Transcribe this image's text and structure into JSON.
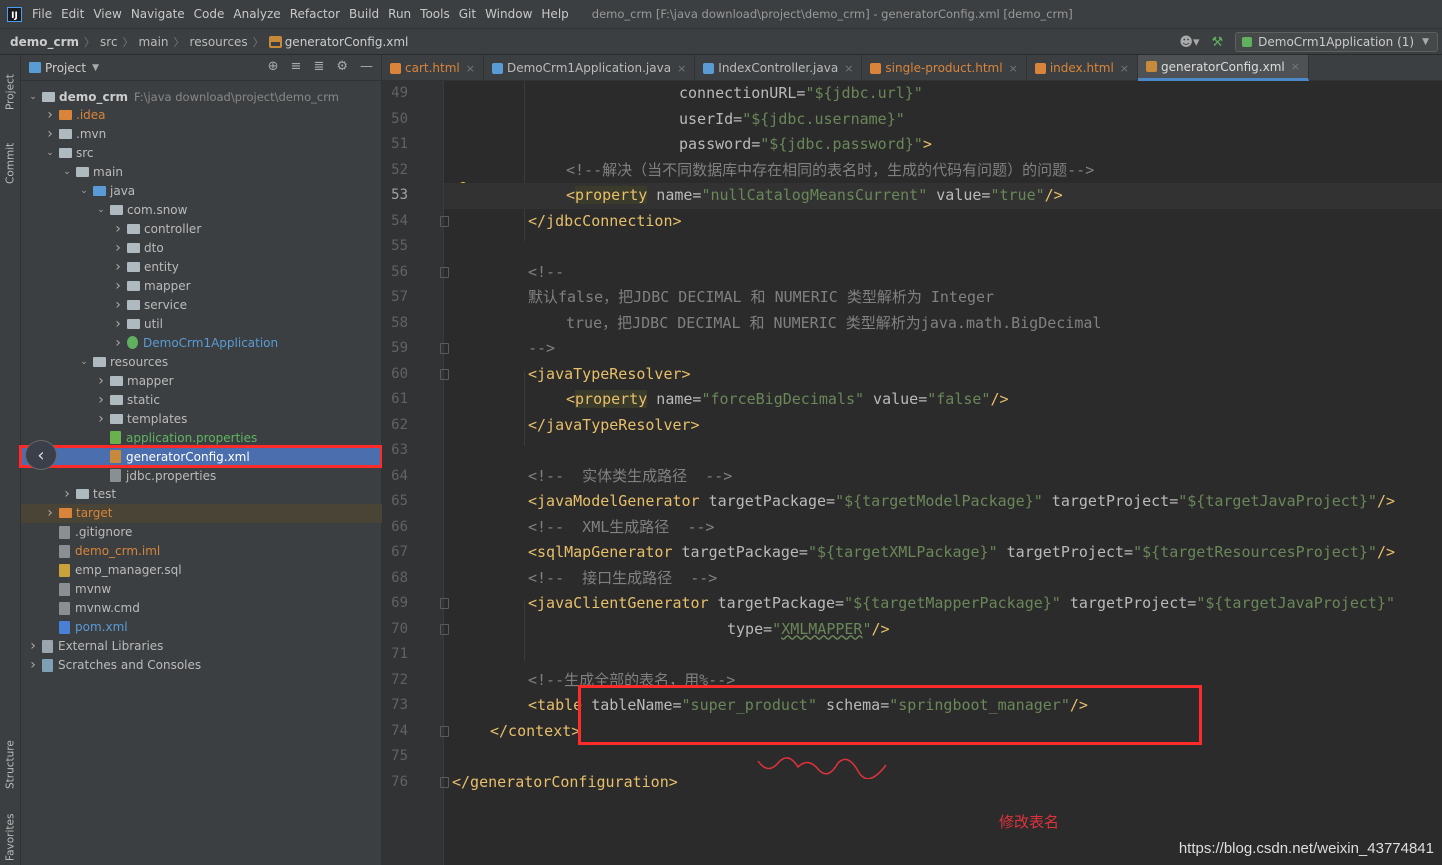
{
  "window": {
    "title": "demo_crm [F:\\java download\\project\\demo_crm] - generatorConfig.xml [demo_crm]"
  },
  "menu": [
    "File",
    "Edit",
    "View",
    "Navigate",
    "Code",
    "Analyze",
    "Refactor",
    "Build",
    "Run",
    "Tools",
    "Git",
    "Window",
    "Help"
  ],
  "breadcrumbs": [
    "demo_crm",
    "src",
    "main",
    "resources",
    "generatorConfig.xml"
  ],
  "run_config": "DemoCrm1Application (1)",
  "side_tabs": {
    "project": "Project",
    "commit": "Commit",
    "structure": "Structure",
    "favorites": "Favorites"
  },
  "project_panel": {
    "title": "Project",
    "root_name": "demo_crm",
    "root_path": "F:\\java download\\project\\demo_crm",
    "tree": [
      {
        "label": ".idea",
        "color": "orange"
      },
      {
        "label": ".mvn",
        "color": "default"
      },
      {
        "label": "src",
        "color": "default"
      },
      {
        "label": "main",
        "color": "default"
      },
      {
        "label": "java",
        "color": "default"
      },
      {
        "label": "com.snow",
        "color": "default"
      },
      {
        "label": "controller",
        "color": "default"
      },
      {
        "label": "dto",
        "color": "default"
      },
      {
        "label": "entity",
        "color": "default"
      },
      {
        "label": "mapper",
        "color": "default"
      },
      {
        "label": "service",
        "color": "default"
      },
      {
        "label": "util",
        "color": "default"
      },
      {
        "label": "DemoCrm1Application",
        "color": "blue"
      },
      {
        "label": "resources",
        "color": "default"
      },
      {
        "label": "mapper",
        "color": "default"
      },
      {
        "label": "static",
        "color": "default"
      },
      {
        "label": "templates",
        "color": "default"
      },
      {
        "label": "application.properties",
        "color": "green"
      },
      {
        "label": "generatorConfig.xml",
        "color": "white"
      },
      {
        "label": "jdbc.properties",
        "color": "default"
      },
      {
        "label": "test",
        "color": "default"
      },
      {
        "label": "target",
        "color": "orange"
      },
      {
        "label": ".gitignore",
        "color": "default"
      },
      {
        "label": "demo_crm.iml",
        "color": "orange"
      },
      {
        "label": "emp_manager.sql",
        "color": "default"
      },
      {
        "label": "mvnw",
        "color": "default"
      },
      {
        "label": "mvnw.cmd",
        "color": "default"
      },
      {
        "label": "pom.xml",
        "color": "blue"
      },
      {
        "label": "External Libraries",
        "color": "default"
      },
      {
        "label": "Scratches and Consoles",
        "color": "default"
      }
    ]
  },
  "tabs": [
    {
      "label": "cart.html",
      "color": "#d9843a",
      "active": false
    },
    {
      "label": "DemoCrm1Application.java",
      "color": "#5a9bd6",
      "active": false
    },
    {
      "label": "IndexController.java",
      "color": "#5a9bd6",
      "active": false
    },
    {
      "label": "single-product.html",
      "color": "#d9843a",
      "active": false
    },
    {
      "label": "index.html",
      "color": "#d9843a",
      "active": false
    },
    {
      "label": "generatorConfig.xml",
      "color": "#c78a3b",
      "active": true
    }
  ],
  "line_numbers": [
    "49",
    "50",
    "51",
    "52",
    "53",
    "54",
    "55",
    "56",
    "57",
    "58",
    "59",
    "60",
    "61",
    "62",
    "63",
    "64",
    "65",
    "66",
    "67",
    "68",
    "69",
    "70",
    "71",
    "72",
    "73",
    "74",
    "75",
    "76"
  ],
  "code": {
    "l49": [
      "connectionURL=",
      "\"${jdbc.url}\""
    ],
    "l50": [
      "userId=",
      "\"${jdbc.username}\""
    ],
    "l51": [
      "password=",
      "\"${jdbc.password}\"",
      ">"
    ],
    "l52": "<!--解决（当不同数据库中存在相同的表名时，生成的代码有问题）的问题-->",
    "l53": [
      "<",
      "property",
      " name=",
      "\"nullCatalogMeansCurrent\"",
      " value=",
      "\"true\"",
      "/>"
    ],
    "l54": "</jdbcConnection>",
    "l56": "<!--",
    "l57": "默认false，把JDBC DECIMAL 和 NUMERIC 类型解析为 Integer",
    "l58": "true，把JDBC DECIMAL 和 NUMERIC 类型解析为java.math.BigDecimal",
    "l59": "-->",
    "l60": "<javaTypeResolver>",
    "l61": [
      "<",
      "property",
      " name=",
      "\"forceBigDecimals\"",
      " value=",
      "\"false\"",
      "/>"
    ],
    "l62": "</javaTypeResolver>",
    "l64": "<!--  实体类生成路径  -->",
    "l65": [
      "<javaModelGenerator",
      " targetPackage=",
      "\"${targetModelPackage}\"",
      " targetProject=",
      "\"${targetJavaProject}\"",
      "/>"
    ],
    "l66": "<!--  XML生成路径  -->",
    "l67": [
      "<sqlMapGenerator",
      " targetPackage=",
      "\"${targetXMLPackage}\"",
      " targetProject=",
      "\"${targetResourcesProject}\"",
      "/>"
    ],
    "l68": "<!--  接口生成路径  -->",
    "l69": [
      "<javaClientGenerator",
      " targetPackage=",
      "\"${targetMapperPackage}\"",
      " targetProject=",
      "\"${targetJavaProject}\""
    ],
    "l70": [
      "type=",
      "\"",
      "XMLMAPPER",
      "\"",
      "/>"
    ],
    "l72": "<!--生成全部的表名，用%-->",
    "l73": [
      "<table",
      " tableName=",
      "\"super_product\"",
      " schema=",
      "\"springboot_manager\"",
      "/>"
    ],
    "l74": "</context>",
    "l76": "</generatorConfiguration>"
  },
  "annotation": "修改表名",
  "watermark": "https://blog.csdn.net/weixin_43774841"
}
